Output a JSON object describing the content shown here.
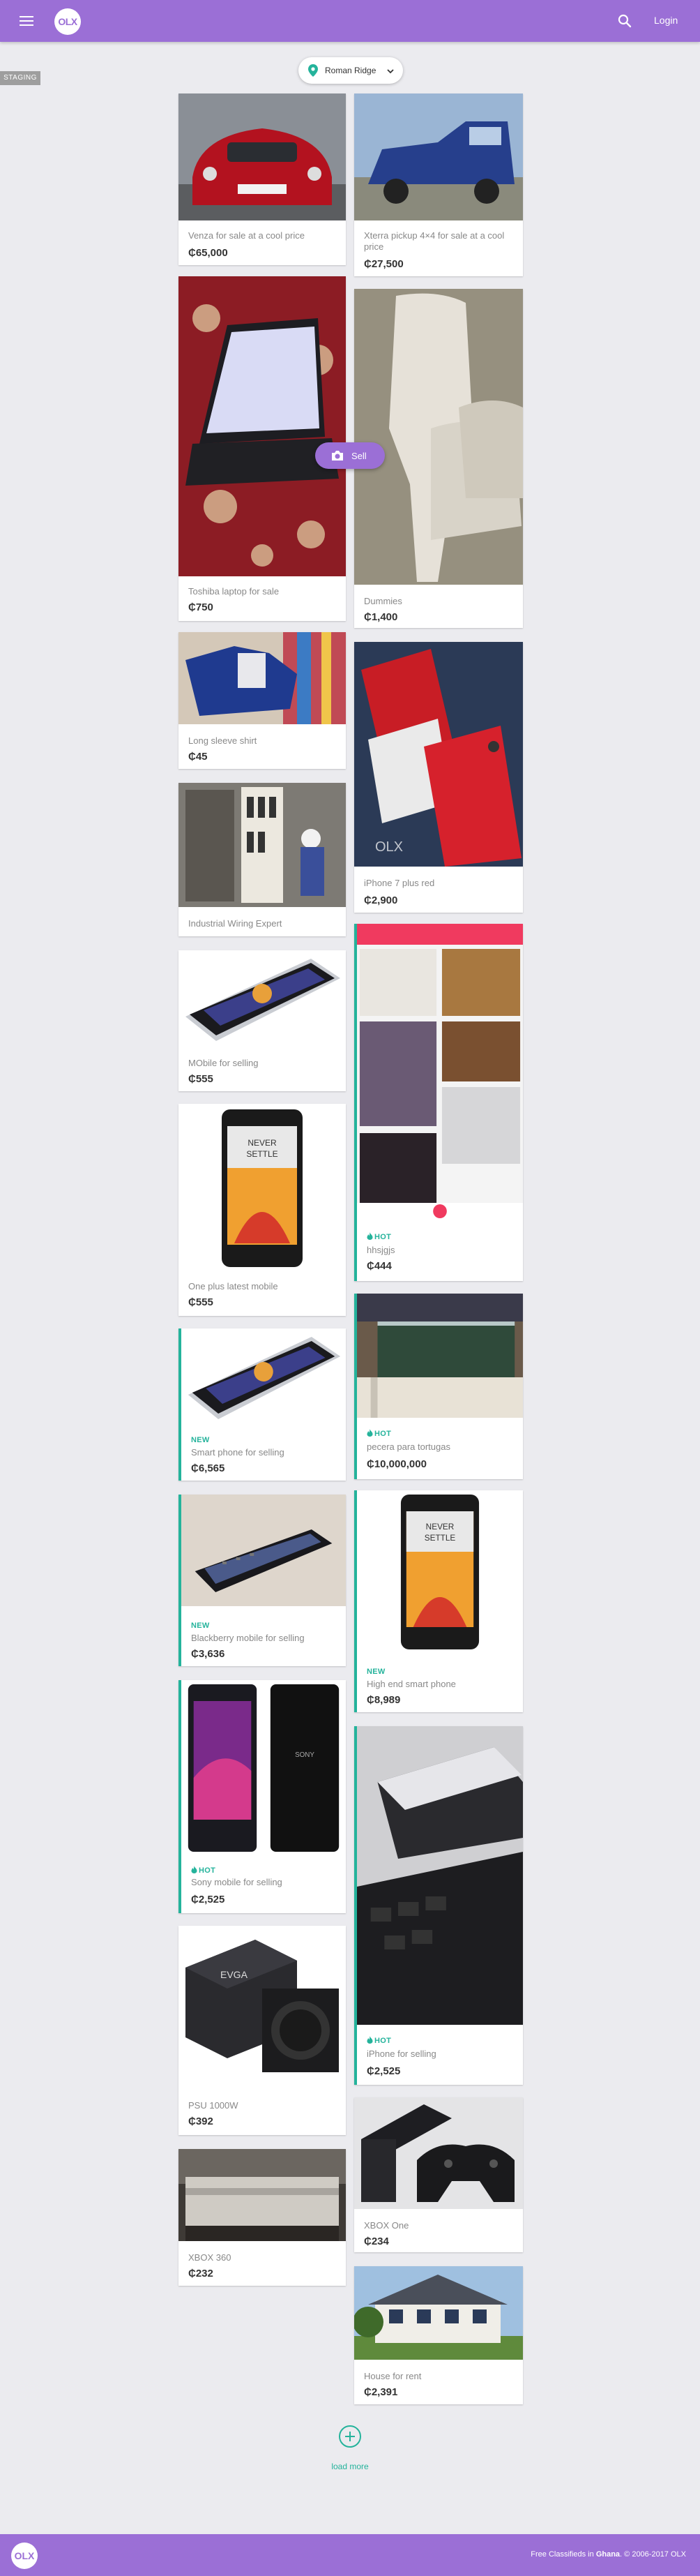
{
  "header": {
    "logo": "OLX",
    "login_label": "Login"
  },
  "env_badge": "STAGING",
  "location": {
    "selected": "Roman Ridge"
  },
  "sell_button": {
    "label": "Sell"
  },
  "listings": [
    {
      "title": "Venza for sale at a cool price",
      "price": "₵65,000",
      "badge": ""
    },
    {
      "title": "Xterra pickup 4×4 for sale at a cool price",
      "price": "₵27,500",
      "badge": ""
    },
    {
      "title": "Toshiba laptop for sale",
      "price": "₵750",
      "badge": ""
    },
    {
      "title": "Dummies",
      "price": "₵1,400",
      "badge": ""
    },
    {
      "title": "Long sleeve shirt",
      "price": "₵45",
      "badge": ""
    },
    {
      "title": "iPhone 7 plus red",
      "price": "₵2,900",
      "badge": ""
    },
    {
      "title": "Industrial Wiring Expert",
      "price": "",
      "badge": ""
    },
    {
      "title": "hhsjgjs",
      "price": "₵444",
      "badge": "HOT"
    },
    {
      "title": "MObile for selling",
      "price": "₵555",
      "badge": ""
    },
    {
      "title": "One plus latest mobile",
      "price": "₵555",
      "badge": ""
    },
    {
      "title": "pecera para tortugas",
      "price": "₵10,000,000",
      "badge": "HOT"
    },
    {
      "title": "Smart phone for selling",
      "price": "₵6,565",
      "badge": "NEW"
    },
    {
      "title": "High end smart phone",
      "price": "₵8,989",
      "badge": "NEW"
    },
    {
      "title": "Blackberry mobile for selling",
      "price": "₵3,636",
      "badge": "NEW"
    },
    {
      "title": "Sony mobile for selling",
      "price": "₵2,525",
      "badge": "HOT"
    },
    {
      "title": "iPhone for selling",
      "price": "₵2,525",
      "badge": "HOT"
    },
    {
      "title": "PSU 1000W",
      "price": "₵392",
      "badge": ""
    },
    {
      "title": "XBOX 360",
      "price": "₵232",
      "badge": ""
    },
    {
      "title": "XBOX One",
      "price": "₵234",
      "badge": ""
    },
    {
      "title": "House for rent",
      "price": "₵2,391",
      "badge": ""
    }
  ],
  "load_more": {
    "label": "load more"
  },
  "footer": {
    "prefix": "Free Classifieds in ",
    "country": "Ghana",
    "suffix": ". © 2006-2017 OLX"
  },
  "colors": {
    "brand": "#9b6fd6",
    "accent": "#24b39b"
  },
  "icons": [
    "menu-icon",
    "search-icon",
    "location-pin-icon",
    "chevron-down-icon",
    "camera-icon",
    "flame-icon",
    "plus-icon"
  ]
}
